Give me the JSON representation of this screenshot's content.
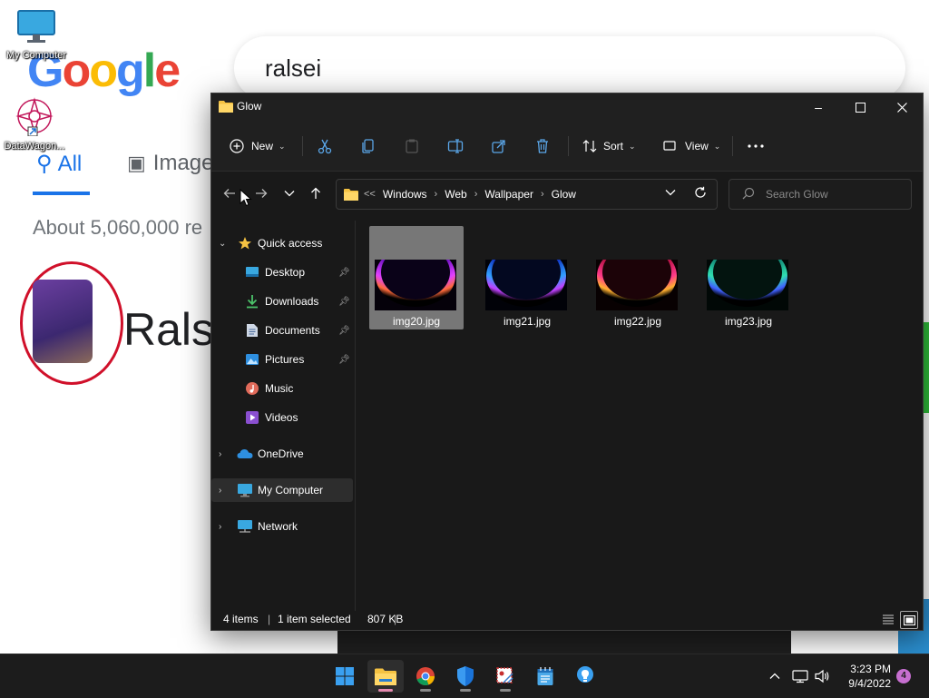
{
  "desktop": {
    "icons": [
      {
        "label": "My Computer"
      },
      {
        "label": "DataWagon..."
      }
    ]
  },
  "browser": {
    "search_query": "ralsei",
    "tabs": [
      {
        "label": "All"
      },
      {
        "label": "Image"
      }
    ],
    "stats": "About 5,060,000 re",
    "result_title": "Rals"
  },
  "explorer": {
    "title": "Glow",
    "toolbar": {
      "new_label": "New",
      "sort_label": "Sort",
      "view_label": "View"
    },
    "breadcrumb": [
      "Windows",
      "Web",
      "Wallpaper",
      "Glow"
    ],
    "breadcrumb_overflow": "<<",
    "search_placeholder": "Search Glow",
    "sidebar": {
      "quick_access": "Quick access",
      "pinned": [
        {
          "label": "Desktop",
          "pinned": true
        },
        {
          "label": "Downloads",
          "pinned": true
        },
        {
          "label": "Documents",
          "pinned": true
        },
        {
          "label": "Pictures",
          "pinned": true
        },
        {
          "label": "Music",
          "pinned": false
        },
        {
          "label": "Videos",
          "pinned": false
        }
      ],
      "onedrive": "OneDrive",
      "my_computer": "My Computer",
      "network": "Network"
    },
    "files": [
      {
        "name": "img20.jpg",
        "selected": true,
        "glow": "#a020f0"
      },
      {
        "name": "img21.jpg",
        "selected": false,
        "glow": "#2a5bff"
      },
      {
        "name": "img22.jpg",
        "selected": false,
        "glow": "#ff2a6a"
      },
      {
        "name": "img23.jpg",
        "selected": false,
        "glow": "#20d0a0"
      }
    ],
    "status": {
      "items": "4 items",
      "selected": "1 item selected",
      "size": "807 KB"
    }
  },
  "taskbar": {
    "time": "3:23 PM",
    "date": "9/4/2022",
    "notifications": "4"
  },
  "colors": {
    "accent": "#0078d4",
    "window_bg": "#191919",
    "selection": "#777777"
  }
}
